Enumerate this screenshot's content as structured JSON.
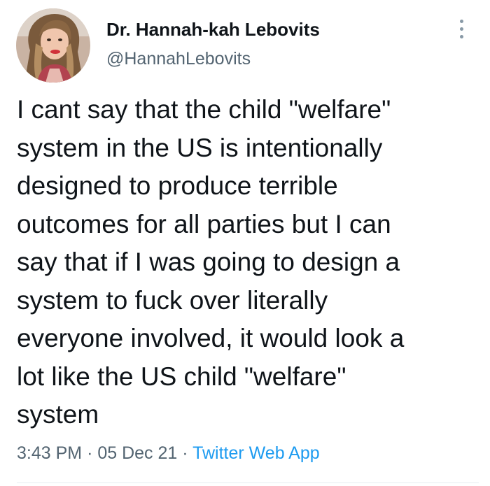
{
  "author": {
    "display_name": "Dr. Hannah-kah Lebovits",
    "handle": "@HannahLebovits",
    "avatar_icon": "profile-photo"
  },
  "more_icon": "more-options-icon",
  "tweet": {
    "lines": [
      "I cant say that the child \"welfare\"",
      "system in the US is intentionally",
      "designed to produce terrible",
      "outcomes for all parties but I can",
      "say that if I was going to design a",
      "system to fuck over literally",
      "everyone involved, it would look a",
      "lot like the US child \"welfare\"",
      "system"
    ]
  },
  "meta": {
    "time": "3:43 PM",
    "separator": "·",
    "date": "05 Dec 21",
    "source": "Twitter Web App"
  },
  "colors": {
    "text": "#0f1419",
    "secondary": "#536471",
    "link": "#1d9bf0"
  }
}
